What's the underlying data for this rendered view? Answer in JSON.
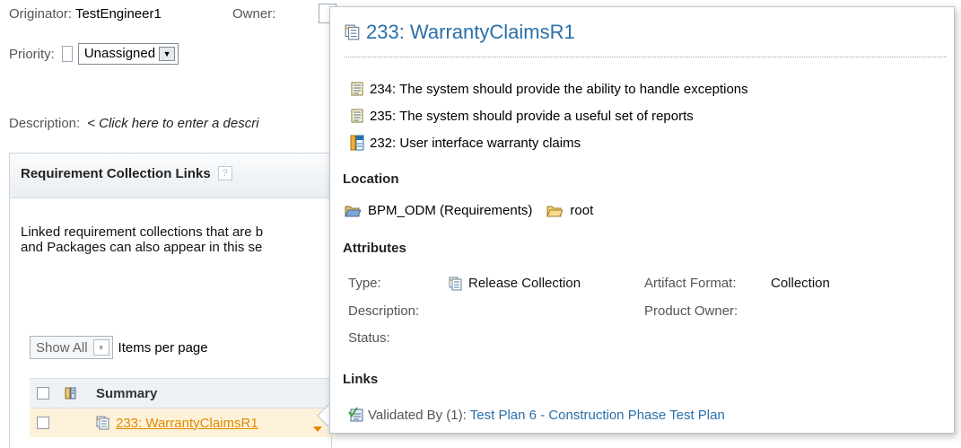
{
  "workitem": {
    "originator_label": "Originator:",
    "originator_value": "TestEngineer1",
    "owner_label": "Owner:",
    "priority_label": "Priority:",
    "priority_value": "Unassigned",
    "description_label": "Description:",
    "description_placeholder": "< Click here to enter a descri"
  },
  "links_panel": {
    "title": "Requirement Collection Links",
    "help_glyph": "?",
    "text_line1": "Linked requirement collections that are b",
    "text_line2": "and Packages can also appear in this se",
    "show_all": "Show All",
    "items_per_page": "Items per page",
    "column_summary": "Summary",
    "row_link": "233: WarrantyClaimsR1"
  },
  "hover_card": {
    "title": "233: WarrantyClaimsR1",
    "requirements": [
      {
        "label": "234: The system should provide the ability to handle exceptions",
        "icon": "requirement-icon"
      },
      {
        "label": "235: The system should provide a useful set of reports",
        "icon": "requirement-icon"
      },
      {
        "label": "232: User interface warranty claims",
        "icon": "ui-sketch-icon"
      }
    ],
    "location_heading": "Location",
    "location_project": "BPM_ODM (Requirements)",
    "location_folder": "root",
    "attributes_heading": "Attributes",
    "attributes": {
      "type_label": "Type:",
      "type_value": "Release Collection",
      "description_label": "Description:",
      "status_label": "Status:",
      "format_label": "Artifact Format:",
      "format_value": "Collection",
      "product_owner_label": "Product Owner:"
    },
    "links_heading": "Links",
    "validated_by_label": "Validated By (1):",
    "validated_by_link": "Test Plan 6 - Construction Phase Test Plan"
  },
  "colors": {
    "title_blue": "#2a6fa8",
    "link_orange": "#e08a00",
    "selected_row": "#fdf2d9"
  }
}
